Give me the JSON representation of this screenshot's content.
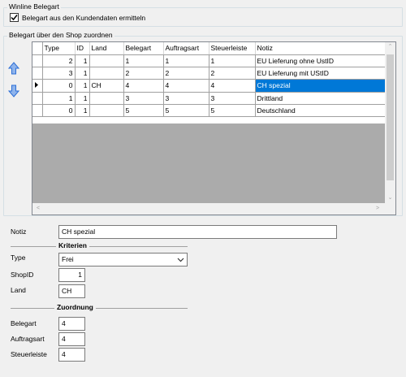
{
  "winline_group": {
    "title": "Winline Belegart",
    "checkbox_label": "Belegart aus den Kundendaten ermitteln",
    "checked": true
  },
  "shop_group": {
    "title": "Belegart über den Shop zuordnen"
  },
  "grid": {
    "columns": [
      "Type",
      "ID",
      "Land",
      "Belegart",
      "Auftragsart",
      "Steuerleiste",
      "Notiz"
    ],
    "rows": [
      {
        "type": "2",
        "id": "1",
        "land": "",
        "belegart": "1",
        "auftragsart": "1",
        "steuerleiste": "1",
        "notiz": "EU Lieferung ohne UstID"
      },
      {
        "type": "3",
        "id": "1",
        "land": "",
        "belegart": "2",
        "auftragsart": "2",
        "steuerleiste": "2",
        "notiz": "EU Lieferung mit UStID"
      },
      {
        "type": "0",
        "id": "1",
        "land": "CH",
        "belegart": "4",
        "auftragsart": "4",
        "steuerleiste": "4",
        "notiz": "CH spezial"
      },
      {
        "type": "1",
        "id": "1",
        "land": "",
        "belegart": "3",
        "auftragsart": "3",
        "steuerleiste": "3",
        "notiz": "Drittland"
      },
      {
        "type": "0",
        "id": "1",
        "land": "",
        "belegart": "5",
        "auftragsart": "5",
        "steuerleiste": "5",
        "notiz": "Deutschland"
      }
    ],
    "selected_row": 2
  },
  "details": {
    "notiz_label": "Notiz",
    "notiz_value": "CH spezial",
    "kriterien_title": "Kriterien",
    "type_label": "Type",
    "type_value": "Frei",
    "shopid_label": "ShopID",
    "shopid_value": "1",
    "land_label": "Land",
    "land_value": "CH",
    "zuordnung_title": "Zuordnung",
    "belegart_label": "Belegart",
    "belegart_value": "4",
    "auftragsart_label": "Auftragsart",
    "auftragsart_value": "4",
    "steuerleiste_label": "Steuerleiste",
    "steuerleiste_value": "4"
  },
  "icons": {
    "up": "move-up-arrow-icon",
    "down": "move-down-arrow-icon",
    "row_indicator": "current-row-pointer-icon"
  },
  "colors": {
    "selection": "#0078d7",
    "arrow_blue": "#2d6fd6"
  }
}
